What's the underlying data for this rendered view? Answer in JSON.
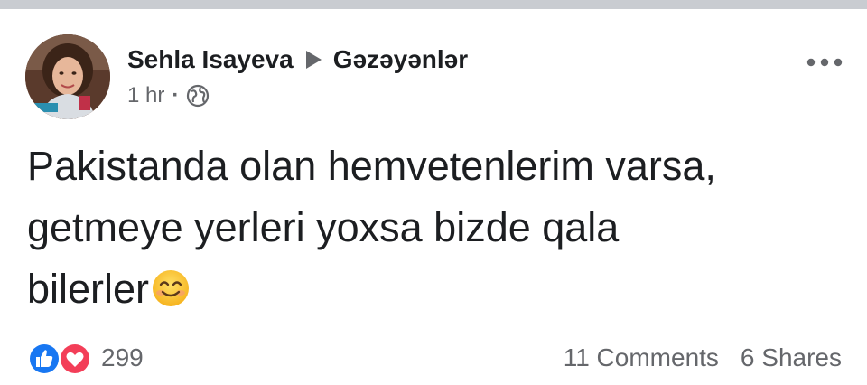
{
  "post": {
    "author": "Sehla Isayeva",
    "group": "Gəzəyənlər",
    "timestamp": "1 hr",
    "separator": "·",
    "privacy_icon": "globe-icon",
    "text_lines": [
      "Pakistanda olan hemvetenlerim varsa,",
      "getmeye yerleri yoxsa bizde qala",
      "bilerler"
    ],
    "emoji": "smiling-face-emoji"
  },
  "footer": {
    "reaction_count": "299",
    "reaction_icons": [
      "like-icon",
      "love-icon"
    ],
    "comments": "11 Comments",
    "shares": "6 Shares"
  },
  "colors": {
    "text": "#1c1e21",
    "secondary": "#65676b",
    "like_blue": "#1877f2",
    "love_red": "#f33e58",
    "top_strip": "#c9ccd1"
  }
}
